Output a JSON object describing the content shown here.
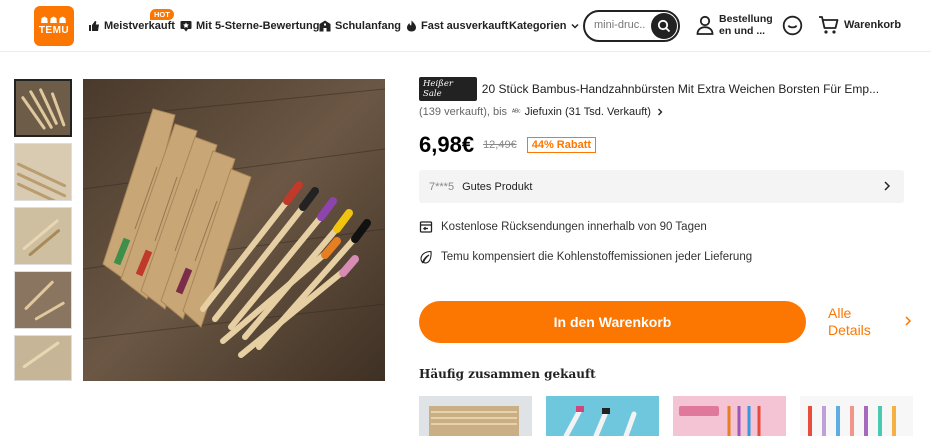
{
  "header": {
    "logo": {
      "glyphs": "☗☗☗",
      "word": "TEMU"
    },
    "nav": [
      {
        "label": "Meistverkauft",
        "icon": "thumbs-up-icon"
      },
      {
        "label": "Mit 5-Sterne-Bewertung",
        "icon": "star-badge-icon"
      },
      {
        "label": "Schulanfang",
        "icon": "school-icon"
      },
      {
        "label": "Fast ausverkauft",
        "icon": "flame-icon"
      },
      {
        "label": "Kategorien",
        "icon": "chevron-down-icon"
      }
    ],
    "hot_badge": "HOT",
    "search_placeholder": "mini-druc...",
    "account_line1": "Bestellung",
    "account_line2": "en und ...",
    "cart_label": "Warenkorb"
  },
  "product": {
    "sale_badge": "Heißer Sale",
    "title": "20 Stück Bambus-Handzahnbürsten Mit Extra Weichen Borsten Für Emp...",
    "sold_text": "(139 verkauft), bis",
    "store_logo": "ᴬᴮᶜ",
    "store_text": "Jiefuxin (31 Tsd. Verkauft)",
    "price": "6,98€",
    "original_price": "12,49€",
    "discount": "44% Rabatt",
    "review_user": "7***5",
    "review_text": "Gutes Produkt",
    "features": [
      "Kostenlose Rücksendungen innerhalb von 90 Tagen",
      "Temu kompensiert die Kohlenstoffemissionen jeder Lieferung"
    ],
    "cta": "In den Warenkorb",
    "details_line1": "Alle",
    "details_line2": "Details",
    "fbt_title": "Häufig zusammen gekauft"
  },
  "colors": {
    "accent": "#fb7701",
    "text": "#222222"
  }
}
